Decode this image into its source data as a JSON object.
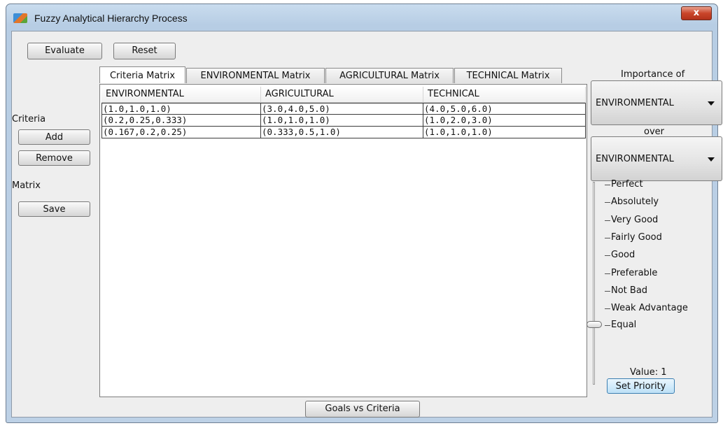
{
  "window": {
    "title": "Fuzzy Analytical Hierarchy Process",
    "close_label": "x"
  },
  "toolbar": {
    "evaluate_label": "Evaluate",
    "reset_label": "Reset"
  },
  "left_panel": {
    "criteria_label": "Criteria",
    "add_label": "Add",
    "remove_label": "Remove",
    "matrix_label": "Matrix",
    "save_label": "Save"
  },
  "tabs": [
    {
      "label": "Criteria Matrix",
      "active": true
    },
    {
      "label": "ENVIRONMENTAL Matrix",
      "active": false
    },
    {
      "label": "AGRICULTURAL Matrix",
      "active": false
    },
    {
      "label": "TECHNICAL Matrix",
      "active": false
    }
  ],
  "table": {
    "columns": [
      "ENVIRONMENTAL",
      "AGRICULTURAL",
      "TECHNICAL"
    ],
    "rows": [
      [
        "(1.0,1.0,1.0)",
        "(3.0,4.0,5.0)",
        "(4.0,5.0,6.0)"
      ],
      [
        "(0.2,0.25,0.333)",
        "(1.0,1.0,1.0)",
        "(1.0,2.0,3.0)"
      ],
      [
        "(0.167,0.2,0.25)",
        "(0.333,0.5,1.0)",
        "(1.0,1.0,1.0)"
      ]
    ]
  },
  "right_panel": {
    "importance_label": "Importance of",
    "first_select": "ENVIRONMENTAL",
    "over_label": "over",
    "second_select": "ENVIRONMENTAL",
    "scale_labels": [
      "Perfect",
      "Absolutely",
      "Very Good",
      "Fairly Good",
      "Good",
      "Preferable",
      "Not Bad",
      "Weak Advantage",
      "Equal"
    ],
    "value_text": "Value: 1",
    "set_priority_label": "Set Priority"
  },
  "bottom": {
    "goals_vs_criteria_label": "Goals vs Criteria"
  }
}
